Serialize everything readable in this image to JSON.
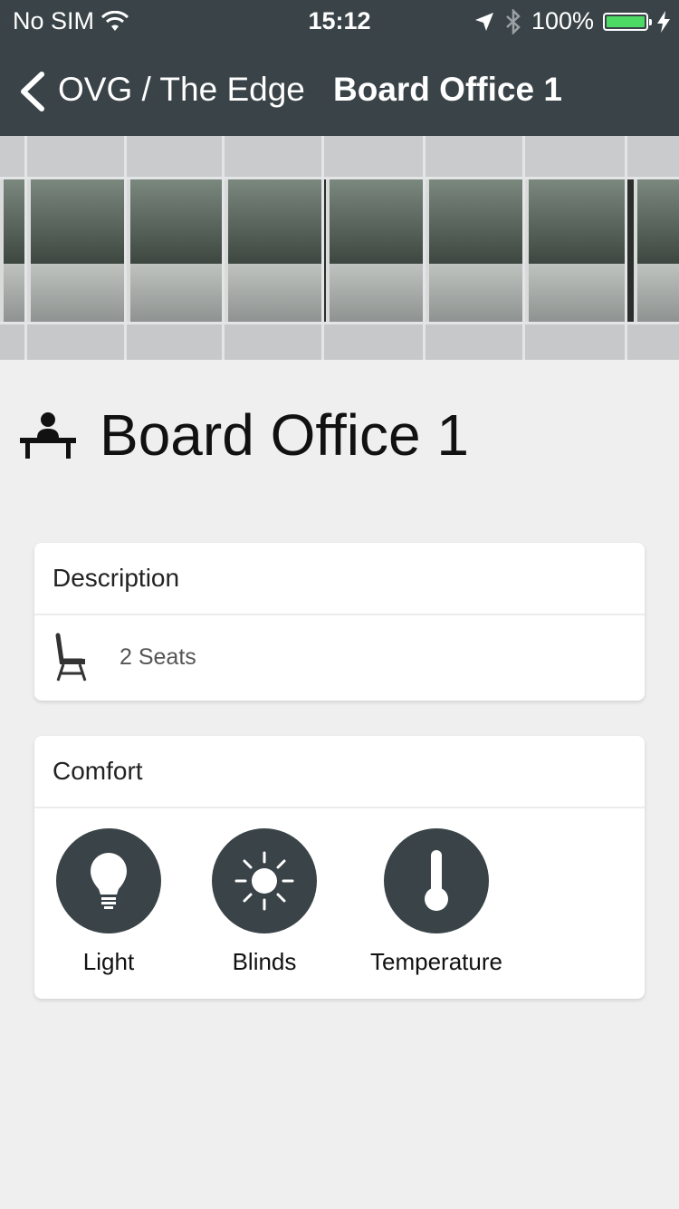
{
  "status_bar": {
    "carrier": "No SIM",
    "time": "15:12",
    "battery": "100%",
    "battery_level": 1.0
  },
  "nav": {
    "breadcrumb": "OVG / The Edge",
    "title": "Board Office 1"
  },
  "room": {
    "name": "Board Office 1"
  },
  "description_card": {
    "header": "Description",
    "seats_label": "2 Seats",
    "seat_icon": "chair-icon"
  },
  "comfort_card": {
    "header": "Comfort",
    "items": [
      {
        "label": "Light",
        "icon": "lightbulb-icon"
      },
      {
        "label": "Blinds",
        "icon": "sun-icon"
      },
      {
        "label": "Temperature",
        "icon": "thermometer-icon"
      }
    ]
  },
  "colors": {
    "header_bg": "#3a4448",
    "page_bg": "#efefef",
    "battery_fill": "#4cd964"
  }
}
